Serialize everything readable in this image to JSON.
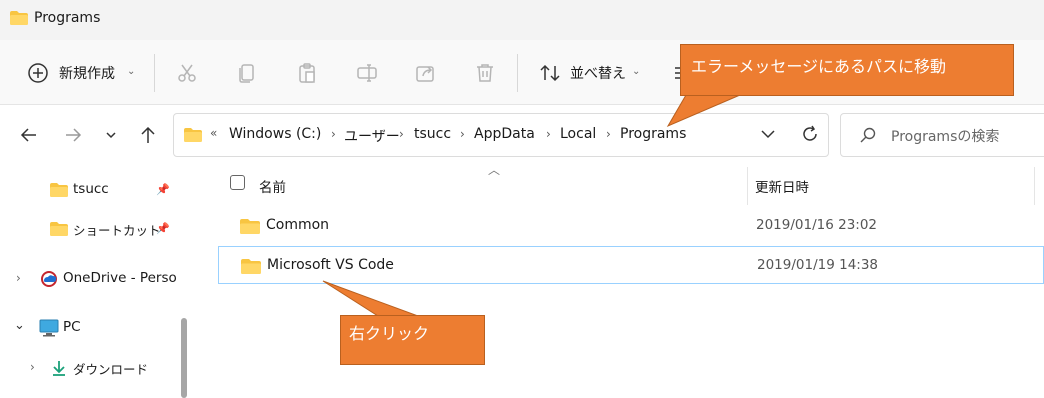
{
  "window": {
    "title": "Programs"
  },
  "toolbar": {
    "new_label": "新規作成",
    "sort_label": "並べ替え"
  },
  "address": {
    "overflow": "«",
    "crumbs": [
      "Windows (C:)",
      "ユーザー",
      "tsucc",
      "AppData",
      "Local",
      "Programs"
    ]
  },
  "search": {
    "placeholder": "Programsの検索"
  },
  "sidebar": {
    "items": [
      {
        "label": "tsucc",
        "icon": "folder-icon",
        "pinned": true
      },
      {
        "label": "ショートカット",
        "icon": "folder-icon",
        "pinned": true
      },
      {
        "label": "OneDrive - Perso",
        "icon": "onedrive-icon",
        "pinned": false
      },
      {
        "label": "PC",
        "icon": "pc-icon",
        "pinned": false
      },
      {
        "label": "ダウンロード",
        "icon": "download-icon",
        "pinned": false
      }
    ]
  },
  "columns": {
    "name": "名前",
    "modified": "更新日時"
  },
  "files": [
    {
      "name": "Common",
      "modified": "2019/01/16 23:02"
    },
    {
      "name": "Microsoft VS Code",
      "modified": "2019/01/19 14:38"
    }
  ],
  "annotations": {
    "top": "エラーメッセージにあるパスに移動",
    "bottom": "右クリック"
  },
  "colors": {
    "callout": "#ed7d31",
    "folder": "#f8c542",
    "selection_border": "#99d1ff"
  }
}
